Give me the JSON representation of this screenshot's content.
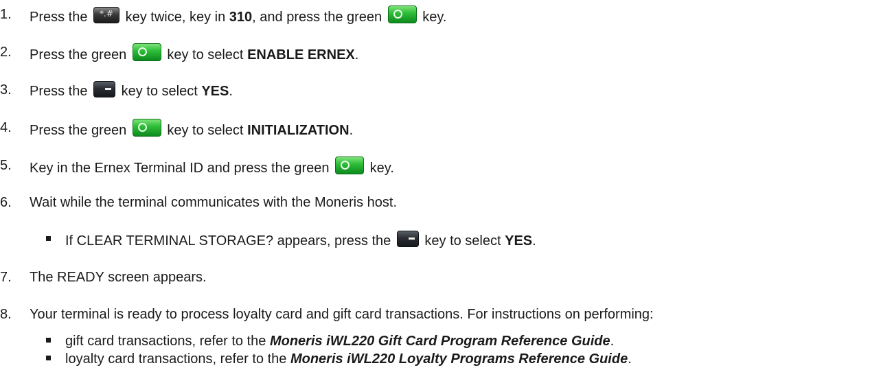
{
  "steps": [
    {
      "num": "1.",
      "p1": "Press the",
      "p2": "key twice, key in",
      "b1": "310",
      "p3": ", and press the green",
      "p4": "key."
    },
    {
      "num": "2.",
      "p1": "Press the green",
      "p2": "key to select",
      "b1": "ENABLE ERNEX",
      "p3": "."
    },
    {
      "num": "3.",
      "p1": "Press the",
      "p2": "key to select",
      "b1": "YES",
      "p3": "."
    },
    {
      "num": "4.",
      "p1": "Press the green",
      "p2": "key to select",
      "b1": "INITIALIZATION",
      "p3": "."
    },
    {
      "num": "5.",
      "p1": "Key in the Ernex Terminal ID and press the green",
      "p2": "key."
    },
    {
      "num": "6.",
      "p1": "Wait while the terminal communicates with the Moneris host."
    },
    {
      "num": "7.",
      "p1": "The READY screen appears."
    },
    {
      "num": "8.",
      "p1": "Your terminal is ready to process loyalty card and gift card transactions. For instructions on performing:"
    }
  ],
  "sub6": {
    "p1": "If CLEAR TERMINAL STORAGE? appears, press the",
    "p2": "key to select",
    "b1": "YES",
    "p3": "."
  },
  "sub8": [
    {
      "p1": "gift card transactions, refer to the",
      "bi": "Moneris iWL220 Gift Card Program Reference Guide",
      "p2": "."
    },
    {
      "p1": "loyalty card transactions, refer to the",
      "bi": "Moneris iWL220 Loyalty Programs Reference Guide",
      "p2": "."
    }
  ],
  "icons": {
    "star_key": "star-hash-key-icon",
    "green_key": "green-ok-key-icon",
    "dark_key": "dark-function-key-icon",
    "star_key_glyph": "*.#"
  }
}
